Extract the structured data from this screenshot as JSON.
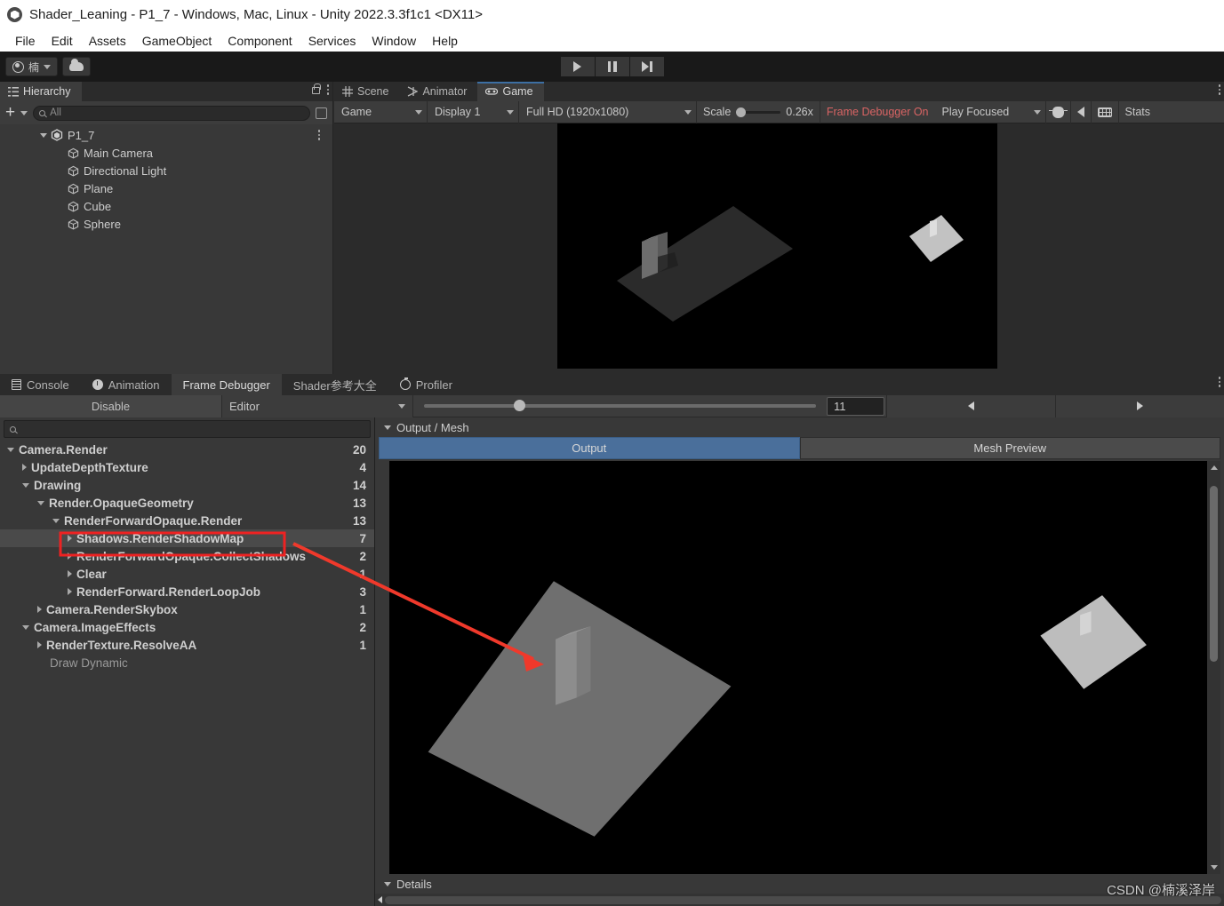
{
  "window": {
    "title": "Shader_Leaning - P1_7 - Windows, Mac, Linux - Unity 2022.3.3f1c1 <DX11>",
    "logo_icon": "unity-logo-icon"
  },
  "menubar": {
    "items": [
      "File",
      "Edit",
      "Assets",
      "GameObject",
      "Component",
      "Services",
      "Window",
      "Help"
    ]
  },
  "toolbar": {
    "account_label": "楠",
    "account_icon": "avatar-icon",
    "cloud_icon": "cloud-icon",
    "play_icon": "play-icon",
    "pause_icon": "pause-icon",
    "step_icon": "step-icon"
  },
  "hierarchy": {
    "tab_label": "Hierarchy",
    "tab_icon": "hierarchy-icon",
    "lock_icon": "lock-icon",
    "menu_icon": "kebab-menu-icon",
    "add_label": "+",
    "search_placeholder": "All",
    "search_value": "",
    "search_icon": "search-icon",
    "picker_icon": "object-picker-icon",
    "scene_name": "P1_7",
    "objects": [
      {
        "label": "Main Camera"
      },
      {
        "label": "Directional Light"
      },
      {
        "label": "Plane"
      },
      {
        "label": "Cube"
      },
      {
        "label": "Sphere"
      }
    ]
  },
  "gameview": {
    "tabs": [
      {
        "label": "Scene",
        "icon": "grid-icon",
        "active": false
      },
      {
        "label": "Animator",
        "icon": "animator-icon",
        "active": false
      },
      {
        "label": "Game",
        "icon": "gamepad-icon",
        "active": true
      }
    ],
    "menu_icon": "kebab-menu-icon",
    "target_display": "Game",
    "display": "Display 1",
    "resolution": "Full HD (1920x1080)",
    "scale_label": "Scale",
    "scale_value": "0.26x",
    "frame_debugger_status": "Frame Debugger On",
    "frame_debugger_status_color": "#d96464",
    "audio_mode": "Play Focused",
    "bug_icon": "bug-icon",
    "mute_icon": "speaker-icon",
    "gizmos_icon": "gizmos-grid-icon",
    "stats_label": "Stats"
  },
  "bottom_dock": {
    "tabs": [
      {
        "label": "Console",
        "icon": "console-icon",
        "active": false
      },
      {
        "label": "Animation",
        "icon": "clock-icon",
        "active": false
      },
      {
        "label": "Frame Debugger",
        "icon": "",
        "active": true
      },
      {
        "label": "Shader参考大全",
        "icon": "",
        "active": false
      },
      {
        "label": "Profiler",
        "icon": "profiler-icon",
        "active": false
      }
    ],
    "menu_icon": "kebab-menu-icon"
  },
  "frame_debugger": {
    "disable_label": "Disable",
    "target_label": "Editor",
    "event_index": "11",
    "prev_icon": "arrow-left-icon",
    "next_icon": "arrow-right-icon",
    "search_value": "",
    "search_icon": "search-icon",
    "tree": [
      {
        "label": "Camera.Render",
        "count": "20",
        "depth": 0,
        "twisty": "down",
        "selected": false,
        "dim": false
      },
      {
        "label": "UpdateDepthTexture",
        "count": "4",
        "depth": 1,
        "twisty": "right",
        "selected": false,
        "dim": false
      },
      {
        "label": "Drawing",
        "count": "14",
        "depth": 1,
        "twisty": "down",
        "selected": false,
        "dim": false
      },
      {
        "label": "Render.OpaqueGeometry",
        "count": "13",
        "depth": 2,
        "twisty": "down",
        "selected": false,
        "dim": false
      },
      {
        "label": "RenderForwardOpaque.Render",
        "count": "13",
        "depth": 3,
        "twisty": "down",
        "selected": false,
        "dim": false
      },
      {
        "label": "Shadows.RenderShadowMap",
        "count": "7",
        "depth": 4,
        "twisty": "right",
        "selected": true,
        "dim": false
      },
      {
        "label": "RenderForwardOpaque.CollectShadows",
        "count": "2",
        "depth": 4,
        "twisty": "right",
        "selected": false,
        "dim": false
      },
      {
        "label": "Clear",
        "count": "1",
        "depth": 4,
        "twisty": "right",
        "selected": false,
        "dim": false
      },
      {
        "label": "RenderForward.RenderLoopJob",
        "count": "3",
        "depth": 4,
        "twisty": "right",
        "selected": false,
        "dim": false
      },
      {
        "label": "Camera.RenderSkybox",
        "count": "1",
        "depth": 2,
        "twisty": "right",
        "selected": false,
        "dim": false
      },
      {
        "label": "Camera.ImageEffects",
        "count": "2",
        "depth": 1,
        "twisty": "down",
        "selected": false,
        "dim": false
      },
      {
        "label": "RenderTexture.ResolveAA",
        "count": "1",
        "depth": 2,
        "twisty": "right",
        "selected": false,
        "dim": false
      },
      {
        "label": "Draw Dynamic",
        "count": "",
        "depth": 2,
        "twisty": "none",
        "selected": false,
        "dim": true
      }
    ],
    "output_mesh_header": "Output / Mesh",
    "output_tab": "Output",
    "mesh_preview_tab": "Mesh Preview",
    "details_header": "Details"
  },
  "annotation": {
    "highlight_target": "Shadows.RenderShadowMap",
    "highlight_color": "#ee2222",
    "arrow_color": "#f0392b"
  },
  "watermark": {
    "text": "CSDN @楠溪泽岸"
  }
}
